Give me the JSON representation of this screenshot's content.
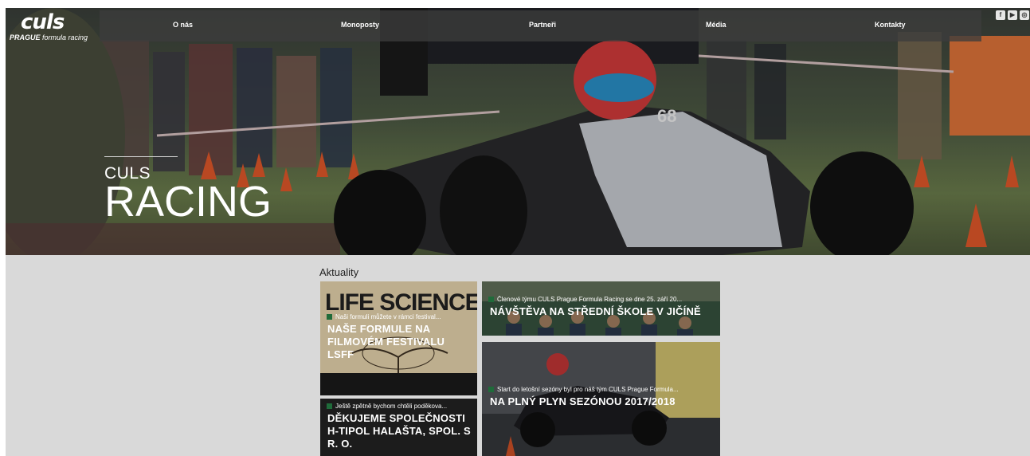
{
  "brand": {
    "logo_mark": "culs",
    "logo_sub_bold": "PRAGUE",
    "logo_sub_rest": " formula racing"
  },
  "nav": {
    "items": [
      "O nás",
      "Monoposty",
      "Partneři",
      "Média",
      "Kontakty"
    ],
    "social_icons": [
      "facebook-icon",
      "youtube-icon",
      "instagram-icon"
    ]
  },
  "hero": {
    "title_top": "CULS",
    "title_main": "RACING"
  },
  "news": {
    "section_title": "Aktuality",
    "cards": [
      {
        "snippet": "Naši formuli můžete v rámci festival...",
        "title": "Naše formule na filmovém festivalu LSFF",
        "image_text": "LIFE SCIENCE"
      },
      {
        "snippet": "Ještě zpětně bychom chtěli poděkova...",
        "title": "Děkujeme společnosti H-TIPOL HALAŠTA, spol. s r. o."
      },
      {
        "snippet": "Členové týmu CULS Prague Formula Racing se dne 25. září 20...",
        "title": "Návštěva na střední škole v Jičíně"
      },
      {
        "snippet": "Start do letošní sezóny byl pro náš tým CULS Prague Formula...",
        "title": "Na plný plyn sezónou 2017/2018"
      }
    ]
  },
  "colors": {
    "page_bg": "#d9d9d9",
    "nav_bg": "#3c3c3c",
    "accent_green": "#1f6b3a"
  }
}
